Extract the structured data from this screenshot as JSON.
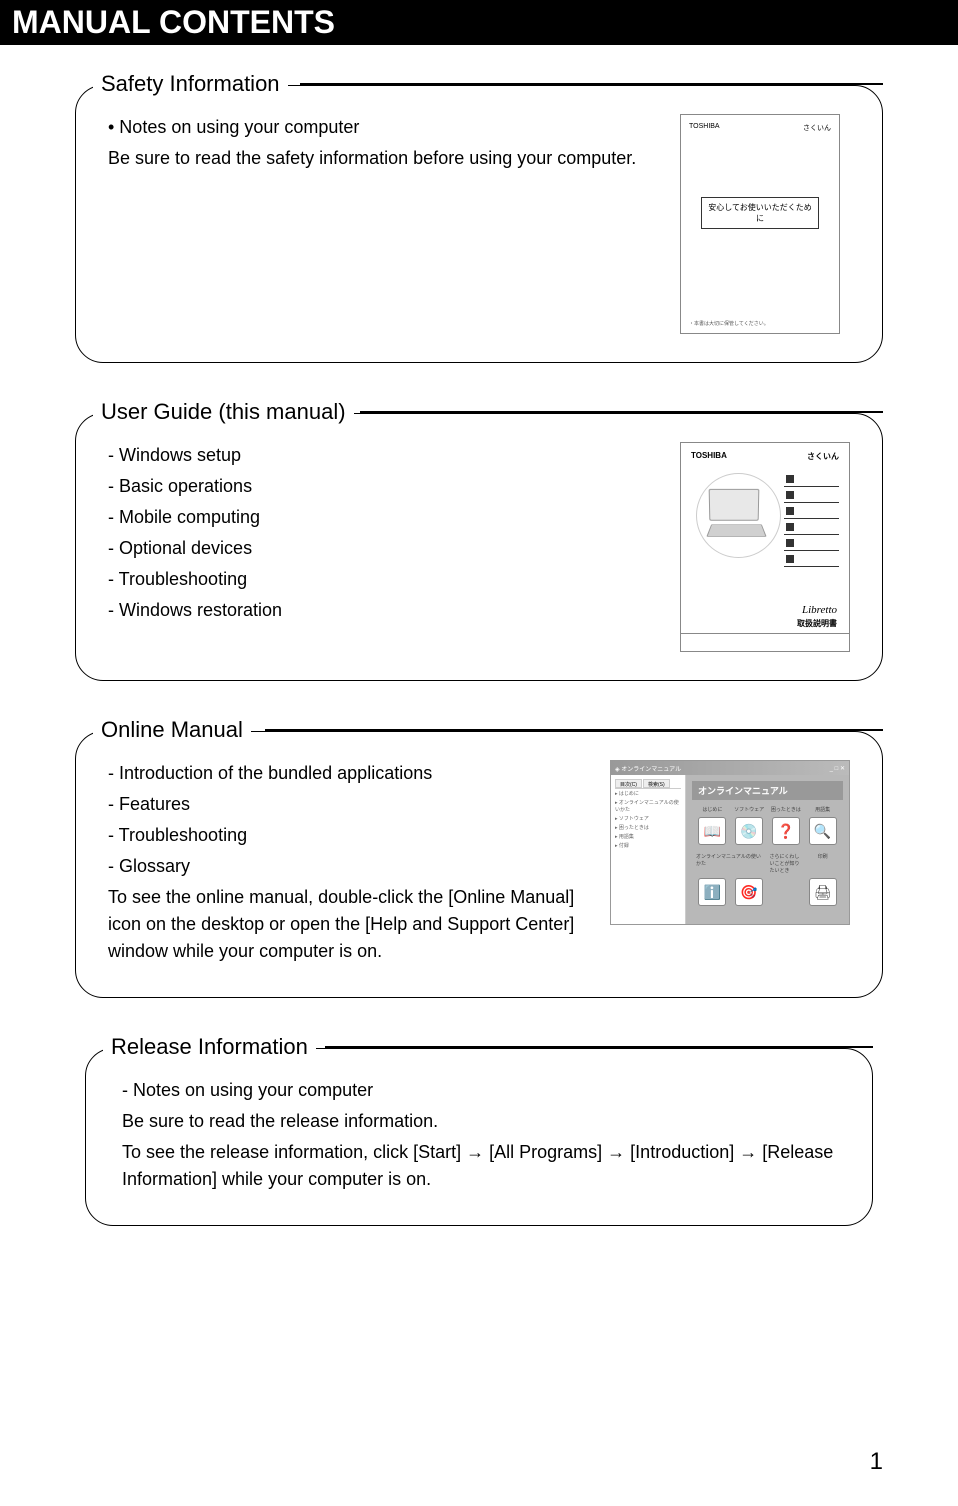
{
  "header": {
    "title": "MANUAL CONTENTS"
  },
  "sections": {
    "safety": {
      "title": "Safety Information",
      "bullet": "• Notes on using your computer",
      "desc": "Be sure to read the safety information before using your computer.",
      "img": {
        "brand_left": "TOSHIBA",
        "brand_right": "さくいん",
        "box_text": "安心してお使いいただくために",
        "footer": "・本書は大切に保管してください。"
      }
    },
    "userguide": {
      "title": "User Guide (this manual)",
      "items": [
        "- Windows setup",
        "- Basic operations",
        "- Mobile computing",
        "- Optional devices",
        "- Troubleshooting",
        "- Windows restoration"
      ],
      "img": {
        "brand": "TOSHIBA",
        "logo": "Libretto",
        "subtitle": "取扱説明書"
      }
    },
    "online": {
      "title": "Online Manual",
      "items": [
        "- Introduction of the bundled applications",
        "- Features",
        "- Troubleshooting",
        "- Glossary"
      ],
      "desc": "To see the online manual, double-click the [Online Manual] icon on the desktop or open the [Help and Support Center] window while your computer is on.",
      "img": {
        "main_title": "オンラインマニュアル",
        "tabs": [
          "はじめに",
          "ソフトウェア",
          "困ったときは",
          "用語集"
        ],
        "bottom_labels": [
          "オンラインマニュアルの使いかた",
          "さらにくわしいことが知りたいとき",
          "",
          "印刷"
        ]
      }
    },
    "release": {
      "title": "Release Information",
      "item": "- Notes on using your computer",
      "desc1": "Be sure to read the release information.",
      "desc2": "To see the release information, click [Start] → [All Programs] → [Introduction] → [Release Information] while your computer is on."
    }
  },
  "page_number": "1"
}
